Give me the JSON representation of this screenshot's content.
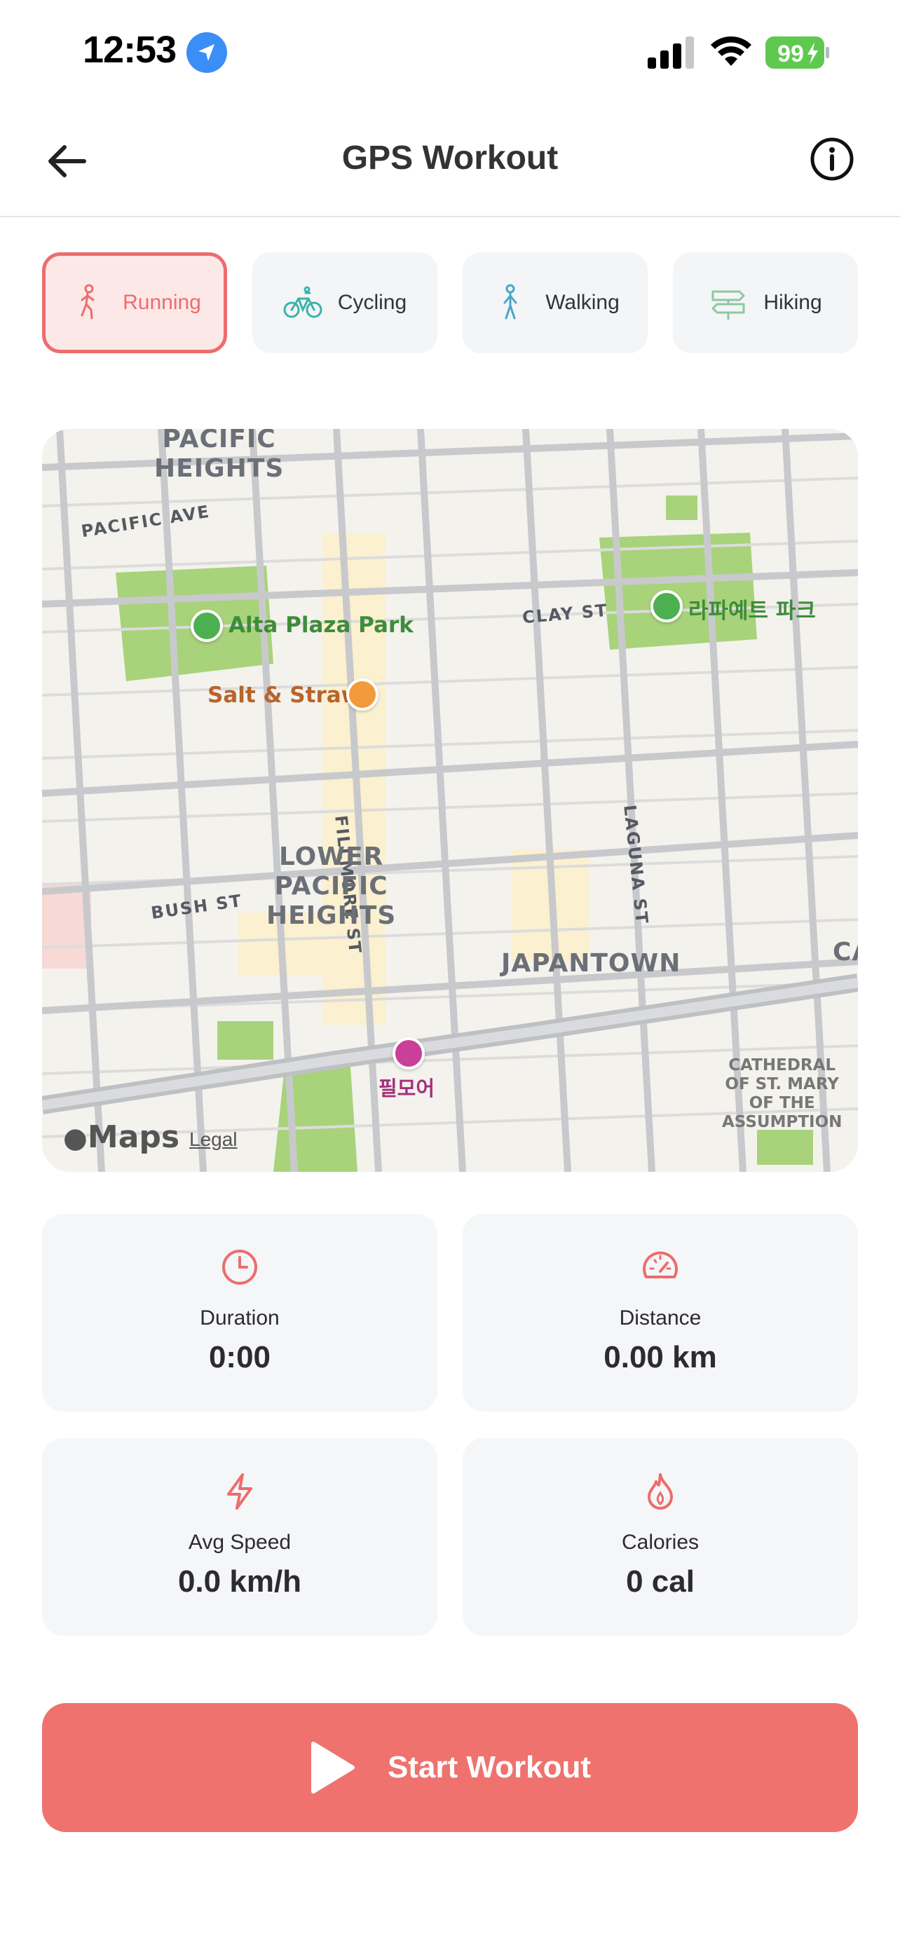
{
  "status_bar": {
    "time": "12:53",
    "battery": "99"
  },
  "header": {
    "title": "GPS Workout",
    "back_icon": "arrow-left-icon",
    "info_icon": "info-circle-icon"
  },
  "activity_tabs": [
    {
      "label": "Running",
      "icon": "running-person-icon",
      "selected": true
    },
    {
      "label": "Cycling",
      "icon": "bicycle-icon",
      "selected": false
    },
    {
      "label": "Walking",
      "icon": "walking-person-icon",
      "selected": false
    },
    {
      "label": "Hiking",
      "icon": "signpost-icon",
      "selected": false
    }
  ],
  "map": {
    "labels": {
      "pacific_heights": "PACIFIC\nHEIGHTS",
      "pacific_ave": "PACIFIC AVE",
      "alta_plaza_park": "Alta Plaza Park",
      "lafayette_park": "라파예트 파크",
      "clay_st": "CLAY ST",
      "salt_straw": "Salt & Straw",
      "fillmore_st": "FILLMORE ST",
      "laguna_st": "LAGUNA ST",
      "lower_pacific_heights": "LOWER\nPACIFIC\nHEIGHTS",
      "bush_st": "BUSH ST",
      "japantown": "JAPANTOWN",
      "ca_partial": "CA",
      "fillmore_music": "필모어",
      "cathedral": "CATHEDRAL\nOF ST. MARY\nOF THE\nASSUMPTION"
    },
    "brand": "Maps",
    "legal": "Legal"
  },
  "stats": [
    {
      "label": "Duration",
      "value": "0:00",
      "icon": "clock-icon"
    },
    {
      "label": "Distance",
      "value": "0.00 km",
      "icon": "speedometer-icon"
    },
    {
      "label": "Avg Speed",
      "value": "0.0 km/h",
      "icon": "lightning-icon"
    },
    {
      "label": "Calories",
      "value": "0 cal",
      "icon": "flame-icon"
    }
  ],
  "start_button": {
    "label": "Start Workout",
    "icon": "play-icon"
  },
  "colors": {
    "accent": "#ef726f",
    "tab_bg": "#f3f5f7",
    "park_green": "#a8d37a",
    "poi_orange": "#f29a3c",
    "poi_pink": "#c93f9a"
  }
}
